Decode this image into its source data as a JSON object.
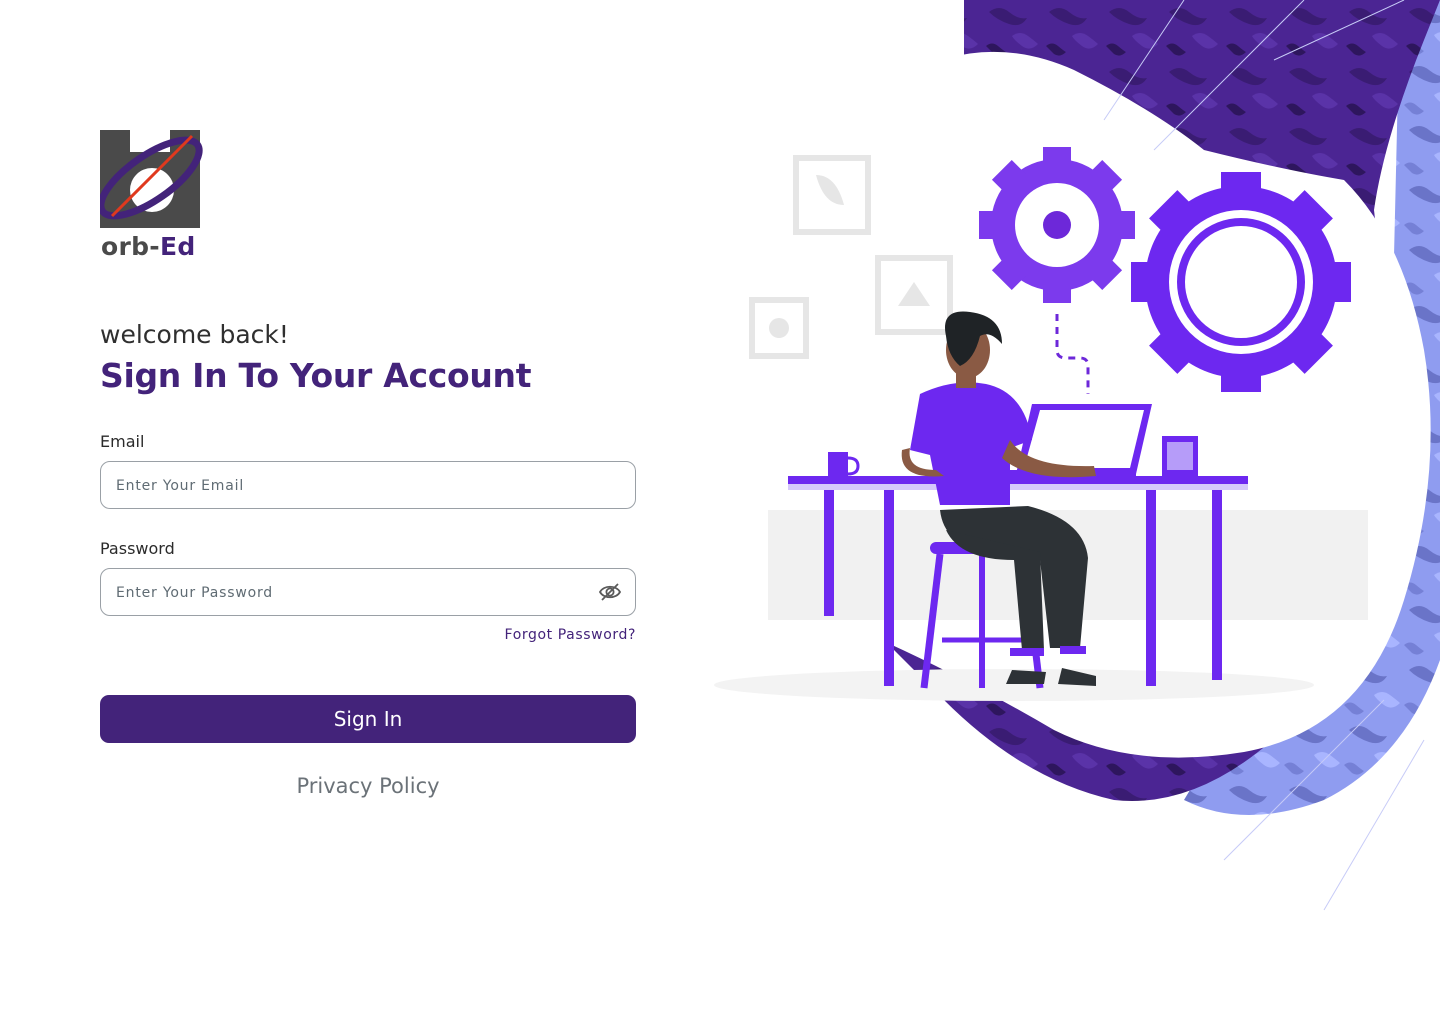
{
  "brand": {
    "name_part1": "orb-",
    "name_part2": "Ed",
    "colors": {
      "primary": "#43237a",
      "accent": "#7b2ff7",
      "logo_gray": "#4a4a4a",
      "logo_red": "#e0391e"
    }
  },
  "header": {
    "welcome": "welcome back!",
    "title": "Sign In To Your Account"
  },
  "form": {
    "email": {
      "label": "Email",
      "placeholder": "Enter Your Email",
      "value": ""
    },
    "password": {
      "label": "Password",
      "placeholder": "Enter Your Password",
      "value": ""
    },
    "forgot_label": "Forgot Password?",
    "submit_label": "Sign In"
  },
  "footer": {
    "privacy_label": "Privacy Policy"
  },
  "icons": {
    "password_toggle": "eye-off-icon"
  },
  "illustration": {
    "subject": "person working at laptop desk with gears"
  }
}
